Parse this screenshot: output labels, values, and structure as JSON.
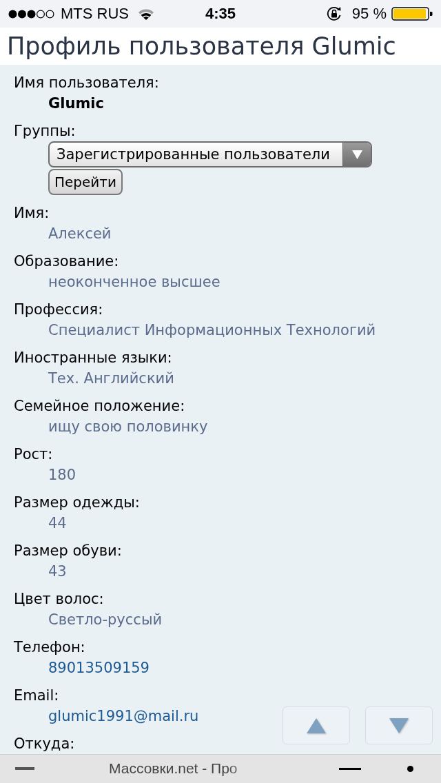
{
  "status_bar": {
    "carrier": "MTS RUS",
    "time": "4:35",
    "battery": "95 %"
  },
  "page_title": "Профиль пользователя Glumic",
  "profile_fields": [
    {
      "label": "Имя пользователя:",
      "kind": "bold",
      "value": "Glumic"
    },
    {
      "label": "Группы:",
      "kind": "select",
      "value": "Зарегистрированные пользователи",
      "button": "Перейти"
    },
    {
      "label": "Имя:",
      "kind": "text",
      "value": "Алексей"
    },
    {
      "label": "Образование:",
      "kind": "text",
      "value": "неоконченное высшее"
    },
    {
      "label": "Профессия:",
      "kind": "text",
      "value": "Специалист Информационных Технологий"
    },
    {
      "label": "Иностранные языки:",
      "kind": "text",
      "value": "Тех. Английский"
    },
    {
      "label": "Семейное положение:",
      "kind": "text",
      "value": "ищу свою половинку"
    },
    {
      "label": "Рост:",
      "kind": "text",
      "value": "180"
    },
    {
      "label": "Размер одежды:",
      "kind": "text",
      "value": "44"
    },
    {
      "label": "Размер обуви:",
      "kind": "text",
      "value": "43"
    },
    {
      "label": "Цвет волос:",
      "kind": "text",
      "value": "Светло-руссый"
    },
    {
      "label": "Телефон:",
      "kind": "link",
      "value": "89013509159"
    },
    {
      "label": "Email:",
      "kind": "link",
      "value": "glumic1991@mail.ru"
    },
    {
      "label": "Откуда:"
    }
  ],
  "scroll_buttons": [
    {
      "kind": "up"
    },
    {
      "kind": "down"
    }
  ],
  "bottom_bar": {
    "page_title": "Массовки.net - Про"
  }
}
